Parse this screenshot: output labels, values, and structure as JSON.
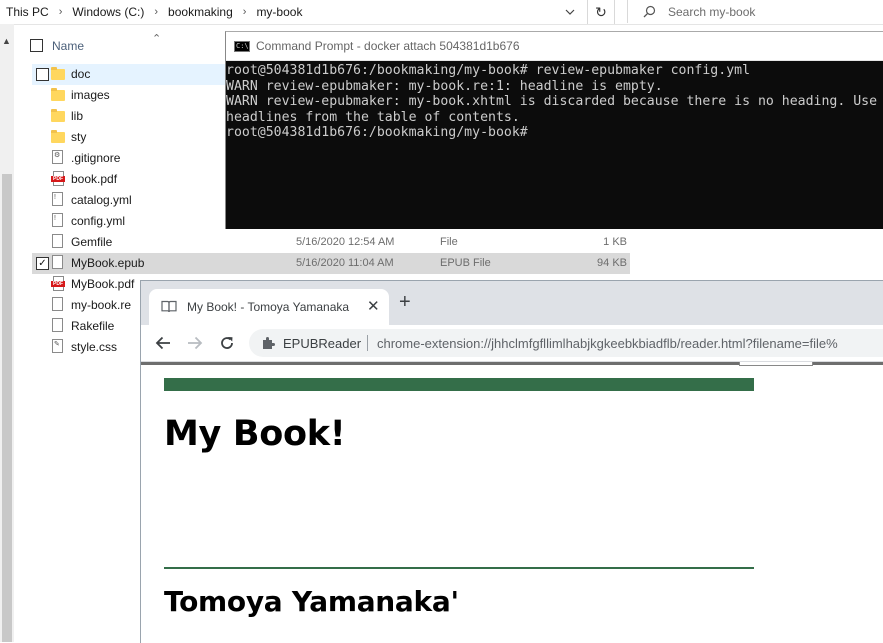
{
  "explorer": {
    "breadcrumb": [
      "This PC",
      "Windows (C:)",
      "bookmaking",
      "my-book"
    ],
    "search_placeholder": "Search my-book",
    "column_name": "Name",
    "files": [
      {
        "name": "doc",
        "icon": "folder-icon",
        "date": "",
        "type": "",
        "size": "",
        "state": "hover"
      },
      {
        "name": "images",
        "icon": "folder-icon",
        "date": "",
        "type": "",
        "size": "",
        "state": ""
      },
      {
        "name": "lib",
        "icon": "folder-icon",
        "date": "",
        "type": "",
        "size": "",
        "state": ""
      },
      {
        "name": "sty",
        "icon": "folder-icon",
        "date": "",
        "type": "",
        "size": "",
        "state": ""
      },
      {
        "name": ".gitignore",
        "icon": "settings-file-icon",
        "date": "",
        "type": "",
        "size": "",
        "state": ""
      },
      {
        "name": "book.pdf",
        "icon": "pdf-icon",
        "date": "",
        "type": "",
        "size": "",
        "state": ""
      },
      {
        "name": "catalog.yml",
        "icon": "yaml-file-icon",
        "date": "",
        "type": "",
        "size": "",
        "state": ""
      },
      {
        "name": "config.yml",
        "icon": "yaml-file-icon",
        "date": "",
        "type": "",
        "size": "",
        "state": ""
      },
      {
        "name": "Gemfile",
        "icon": "file-icon",
        "date": "5/16/2020 12:54 AM",
        "type": "File",
        "size": "1 KB",
        "state": ""
      },
      {
        "name": "MyBook.epub",
        "icon": "file-icon",
        "date": "5/16/2020 11:04 AM",
        "type": "EPUB File",
        "size": "94 KB",
        "state": "checked"
      },
      {
        "name": "MyBook.pdf",
        "icon": "pdf-icon",
        "date": "",
        "type": "",
        "size": "",
        "state": ""
      },
      {
        "name": "my-book.re",
        "icon": "file-icon",
        "date": "",
        "type": "",
        "size": "",
        "state": ""
      },
      {
        "name": "Rakefile",
        "icon": "file-icon",
        "date": "",
        "type": "",
        "size": "",
        "state": ""
      },
      {
        "name": "style.css",
        "icon": "css-file-icon",
        "date": "",
        "type": "",
        "size": "",
        "state": ""
      }
    ]
  },
  "cmd": {
    "title": "Command Prompt - docker  attach 504381d1b676",
    "lines": [
      "root@504381d1b676:/bookmaking/my-book# review-epubmaker config.yml",
      "WARN review-epubmaker: my-book.re:1: headline is empty.",
      "WARN review-epubmaker: my-book.xhtml is discarded because there is no heading. Use",
      "headlines from the table of contents.",
      "root@504381d1b676:/bookmaking/my-book#"
    ]
  },
  "browser": {
    "tab_title": "My Book! - Tomoya Yamanaka",
    "extension_label": "EPUBReader",
    "url": "chrome-extension://jhhclmfgfllimlhabjkgkeebkbiadflb/reader.html?filename=file%",
    "book_title": "My Book!",
    "book_author": "Tomoya Yamanaka'"
  },
  "colors": {
    "accent_green": "#346e49",
    "terminal_bg": "#0c0c0c",
    "terminal_text": "#cccccc",
    "pdf_red": "#d6191a",
    "folder_yellow": "#ffd75e"
  }
}
